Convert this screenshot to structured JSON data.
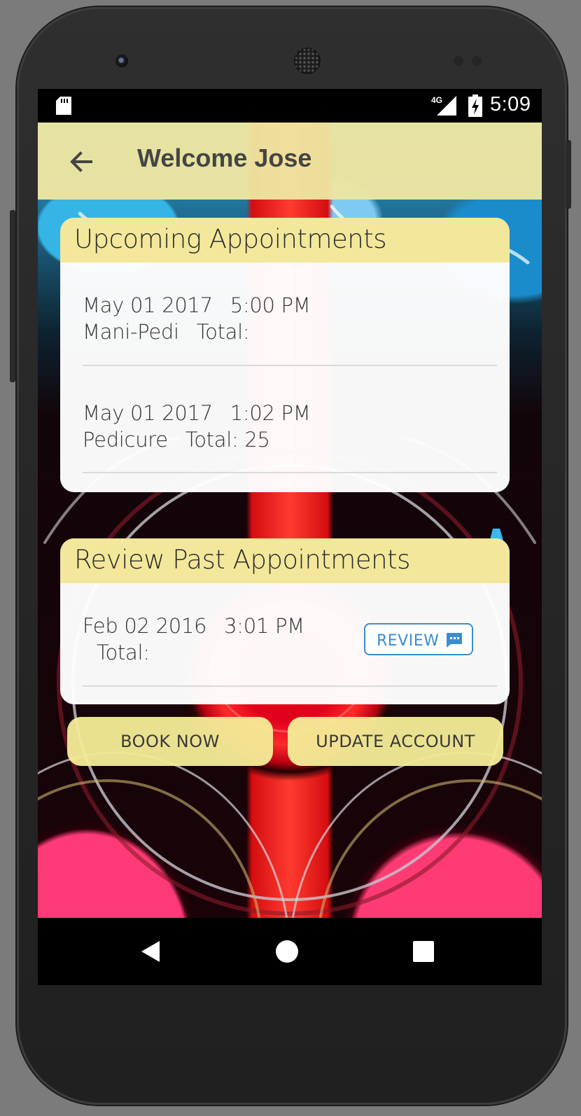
{
  "status_bar": {
    "time": "5:09",
    "network": "4G"
  },
  "app_bar": {
    "title": "Welcome Jose",
    "back_icon": "arrow-left-icon"
  },
  "upcoming": {
    "heading": "Upcoming Appointments",
    "items": [
      {
        "date": "May 01 2017",
        "time": "5:00 PM",
        "service": "Mani-Pedi",
        "total": "Total:"
      },
      {
        "date": "May 01 2017",
        "time": "1:02 PM",
        "service": "Pedicure",
        "total": "Total: 25"
      }
    ]
  },
  "past": {
    "heading": "Review Past Appointments",
    "items": [
      {
        "date": "Feb 02 2016",
        "time": "3:01 PM",
        "total": "Total:",
        "review_label": "REVIEW",
        "review_icon": "chat-bubble-icon"
      }
    ]
  },
  "actions": {
    "book_label": "BOOK NOW",
    "update_label": "UPDATE ACCOUNT"
  },
  "colors": {
    "app_bar": "#EEE6A0",
    "accent": "#3A8ED0",
    "card": "#FFFFFF"
  }
}
